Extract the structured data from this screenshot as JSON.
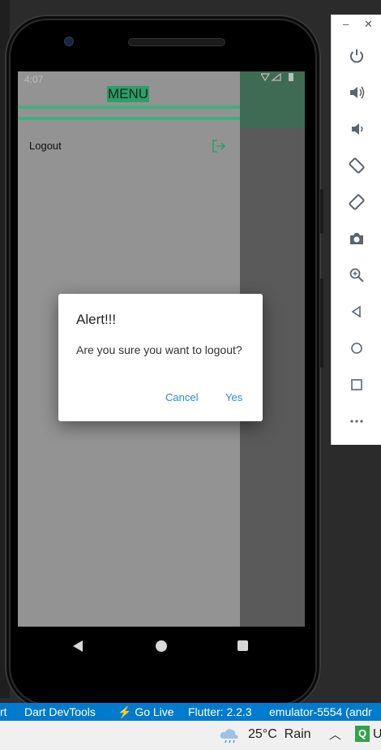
{
  "phone": {
    "status_time": "4:07",
    "drawer": {
      "title": "MENU",
      "items": [
        {
          "label": "Logout"
        }
      ]
    },
    "dialog": {
      "title": "Alert!!!",
      "message": "Are you sure you want to logout?",
      "cancel_label": "Cancel",
      "confirm_label": "Yes"
    }
  },
  "emulator_toolbar": {
    "buttons": [
      "power-icon",
      "volume-up-icon",
      "volume-down-icon",
      "rotate-left-icon",
      "rotate-right-icon",
      "camera-icon",
      "zoom-icon",
      "back-icon",
      "home-icon",
      "overview-icon",
      "more-icon"
    ]
  },
  "status_bar": {
    "items": [
      "rt",
      "Dart DevTools",
      "Go Live",
      "Flutter: 2.2.3",
      "emulator-5554 (andr"
    ]
  },
  "taskbar": {
    "temperature": "25°C",
    "condition": "Rain",
    "q_label": "Q",
    "edge_label": "U"
  }
}
